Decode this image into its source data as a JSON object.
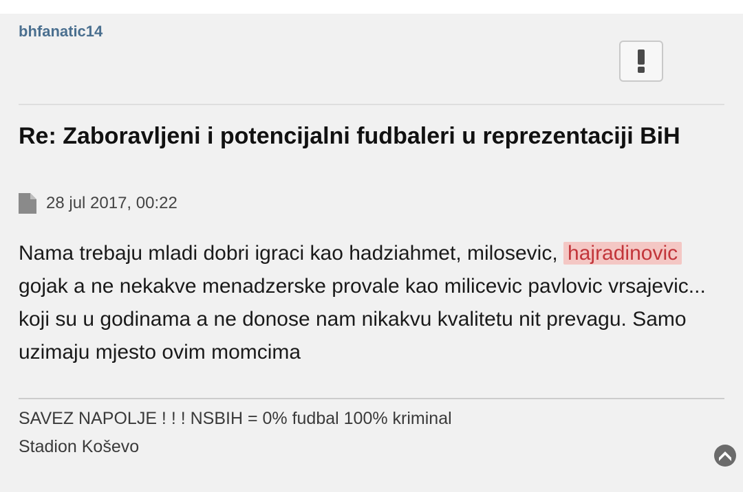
{
  "post": {
    "author": "bhfanatic14",
    "title": "Re: Zaboravljeni i potencijalni fudbaleri u reprezentaciji BiH",
    "date": "28 jul 2017, 00:22",
    "content": {
      "part1": "Nama trebaju mladi dobri igraci kao hadziahmet, milosevic,",
      "highlighted": "hajradinovic",
      "part2": "gojak a ne nekakve menadzerske provale kao milicevic pavlovic vrsajevic... koji su u godinama a ne donose nam nikakvu kvalitetu nit prevagu. Samo uzimaju mjesto ovim momcima"
    },
    "signature": {
      "line1": "SAVEZ NAPOLJE ! ! ! NSBIH = 0% fudbal 100% kriminal",
      "line2": "Stadion Koševo"
    }
  },
  "icons": {
    "report": "exclamation-icon",
    "post_date": "file-icon",
    "scroll": "chevron-up-icon"
  },
  "colors": {
    "author": "#4a6f8f",
    "highlight_bg": "#f4c7c4",
    "highlight_text": "#c2353a",
    "panel_bg": "#f1f1f1"
  }
}
